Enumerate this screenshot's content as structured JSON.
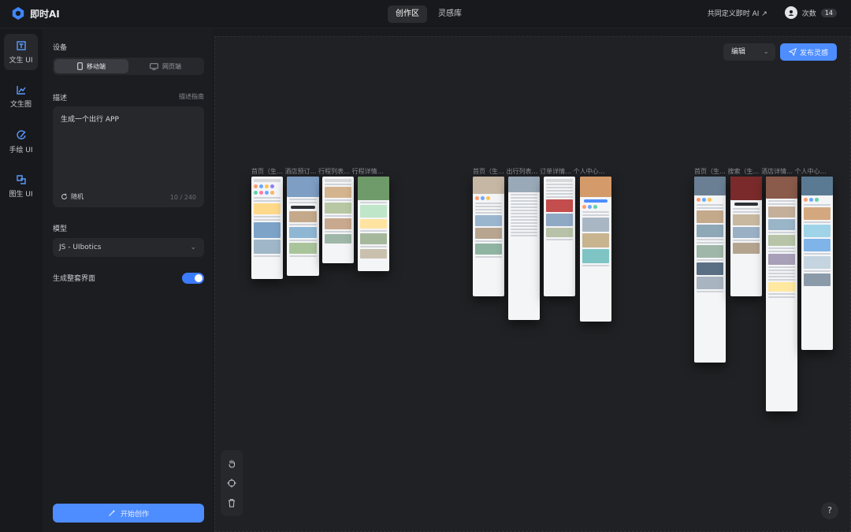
{
  "app": {
    "name": "即时AI"
  },
  "top_tabs": [
    {
      "label": "创作区"
    },
    {
      "label": "灵感库"
    }
  ],
  "top_right": {
    "custom_link": "共同定义即时 AI ↗",
    "credits_label": "次数",
    "credits_count": "14"
  },
  "rail": [
    {
      "label": "文生 UI",
      "icon": "text-to-ui-icon"
    },
    {
      "label": "文生图",
      "icon": "text-to-image-icon"
    },
    {
      "label": "手绘 UI",
      "icon": "sketch-ui-icon"
    },
    {
      "label": "图生 UI",
      "icon": "image-to-ui-icon"
    }
  ],
  "panel": {
    "device_label": "设备",
    "device_options": [
      {
        "label": "移动端"
      },
      {
        "label": "网页端"
      }
    ],
    "desc_label": "描述",
    "desc_guide": "描述指南",
    "desc_value": "生成一个出行 APP",
    "random_label": "随机",
    "char_count": "10 / 240",
    "model_label": "模型",
    "model_value": "JS - UIbotics",
    "full_ui_label": "生成整套界面",
    "start_label": "开始创作"
  },
  "canvas": {
    "edit_label": "编辑",
    "publish_label": "发布灵感",
    "groups": [
      {
        "title": "首页（生…  酒店预订…  行程列表…  行程详情…"
      },
      {
        "title": "首页（生…  出行列表…  订单详情…  个人中心…"
      },
      {
        "title": "首页（生…  搜索（生…  酒店详情…  个人中心…"
      }
    ],
    "help_label": "?"
  },
  "colors": {
    "accent": "#4d8dff",
    "bg": "#1a1b1e",
    "panel": "#1c1d21",
    "canvas": "#202124"
  }
}
